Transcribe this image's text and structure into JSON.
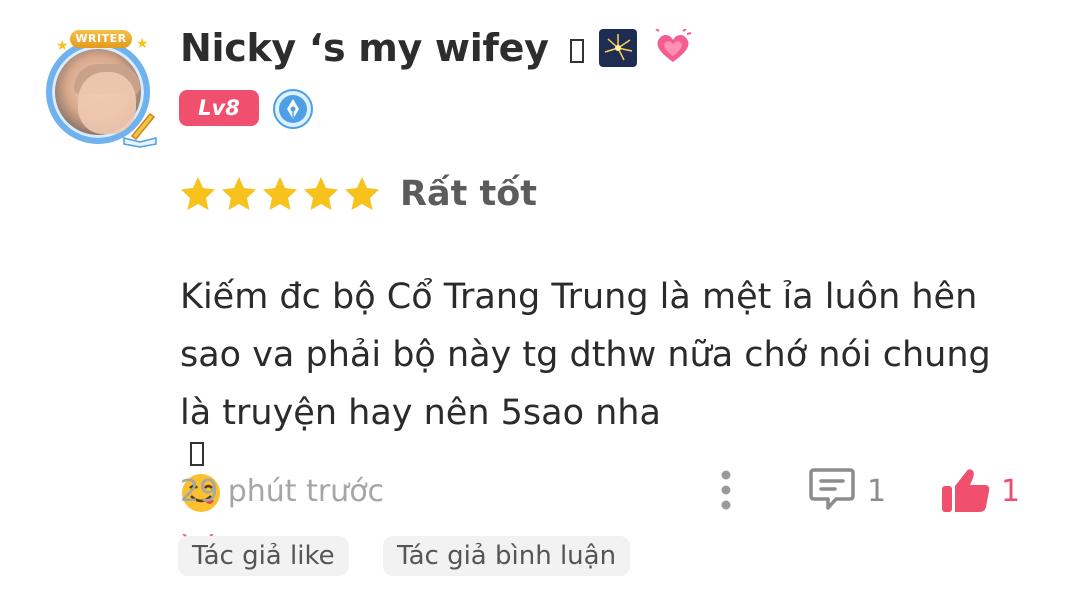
{
  "user": {
    "name": "Nicky ‘s my wifey",
    "name_emojis": [
      "box-glyph",
      "fireworks",
      "growing-heart"
    ],
    "level": "Lv8",
    "avatar_badge": "WRITER",
    "icons": {
      "avatar": "user-avatar",
      "author_badge": "pen-nib-icon"
    }
  },
  "rating": {
    "stars": 5,
    "max_stars": 5,
    "label": "Rất tốt",
    "star_color": "#f6c21b"
  },
  "review": {
    "lines": [
      "Kiếm đc bộ Cổ Trang Trung là mệt ỉa luôn hên",
      "sao va phải bộ này tg dthw nữa chớ nói chung",
      "là truyện hay nên 5sao nha"
    ],
    "trailing_emojis": [
      "box-glyph",
      "yum-face",
      "growing-heart"
    ]
  },
  "meta": {
    "time": "29 phút trước",
    "comment_count": "1",
    "like_count": "1",
    "like_color": "#f0506e"
  },
  "tags": [
    "Tác giả like",
    "Tác giả bình luận"
  ]
}
